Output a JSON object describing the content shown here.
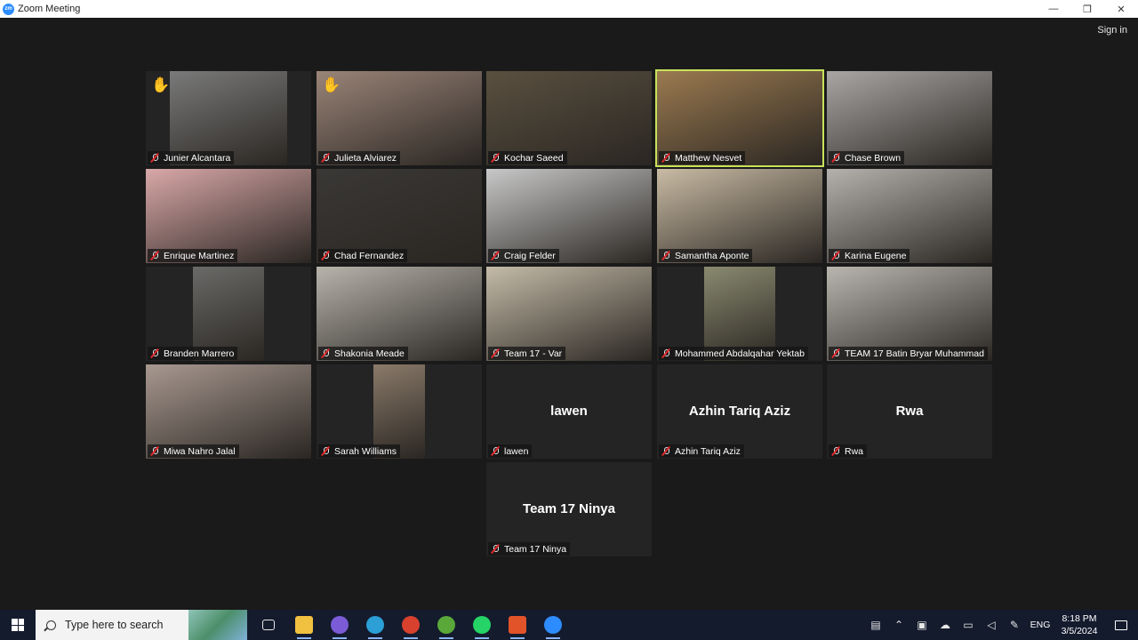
{
  "window": {
    "title": "Zoom Meeting",
    "minimize": "—",
    "maximize": "❐",
    "close": "✕"
  },
  "header": {
    "sign_in": "Sign in"
  },
  "participants": [
    {
      "name": "Junier Alcantara",
      "hand": "✋",
      "video": "#7a7a7a"
    },
    {
      "name": "Julieta Alviarez",
      "hand": "✋",
      "video": "#9a8478"
    },
    {
      "name": "Kochar Saeed",
      "video": "#5a5040"
    },
    {
      "name": "Matthew Nesvet",
      "active": true,
      "video": "#9b7a50"
    },
    {
      "name": "Chase Brown",
      "video": "#a9a6a4"
    },
    {
      "name": "Enrique Martinez",
      "video": "#d9a8a8"
    },
    {
      "name": "Chad Fernandez",
      "video": "#3a3836"
    },
    {
      "name": "Craig Felder",
      "video": "#c8c8c8"
    },
    {
      "name": "Samantha Aponte",
      "video": "#c9bba4"
    },
    {
      "name": "Karina Eugene",
      "video": "#b5b2ae"
    },
    {
      "name": "Branden Marrero",
      "video": "#6a6a68"
    },
    {
      "name": "Shakonia Meade",
      "video": "#b8b4ac"
    },
    {
      "name": "Team 17 - Var",
      "video": "#c4bba8"
    },
    {
      "name": "Mohammed Abdalqahar Yektab",
      "video": "#8a8a70"
    },
    {
      "name": "TEAM 17 Batin Bryar Muhammad",
      "video": "#b9b6b0"
    },
    {
      "name": "Miwa Nahro Jalal",
      "video": "#a89890"
    },
    {
      "name": "Sarah Williams",
      "video": "#8a7a6a"
    },
    {
      "name": "lawen",
      "center_name": "lawen"
    },
    {
      "name": "Azhin Tariq Aziz",
      "center_name": "Azhin Tariq Aziz"
    },
    {
      "name": "Rwa",
      "center_name": "Rwa"
    },
    {
      "name": "Team 17 Ninya",
      "center_name": "Team 17 Ninya"
    }
  ],
  "taskbar": {
    "search_placeholder": "Type here to search",
    "apps": [
      {
        "name": "task-view",
        "color": "#e8e8e8"
      },
      {
        "name": "file-explorer",
        "color": "#f0c040"
      },
      {
        "name": "viber",
        "color": "#7b5cd6"
      },
      {
        "name": "edge",
        "color": "#2b9fd6"
      },
      {
        "name": "chrome",
        "color": "#d9412f"
      },
      {
        "name": "utorrent",
        "color": "#5aa83a"
      },
      {
        "name": "whatsapp",
        "color": "#25d366"
      },
      {
        "name": "office",
        "color": "#e2532a"
      },
      {
        "name": "zoom",
        "color": "#2d8cff"
      }
    ],
    "language": "ENG",
    "time": "8:18 PM",
    "date": "3/5/2024"
  }
}
